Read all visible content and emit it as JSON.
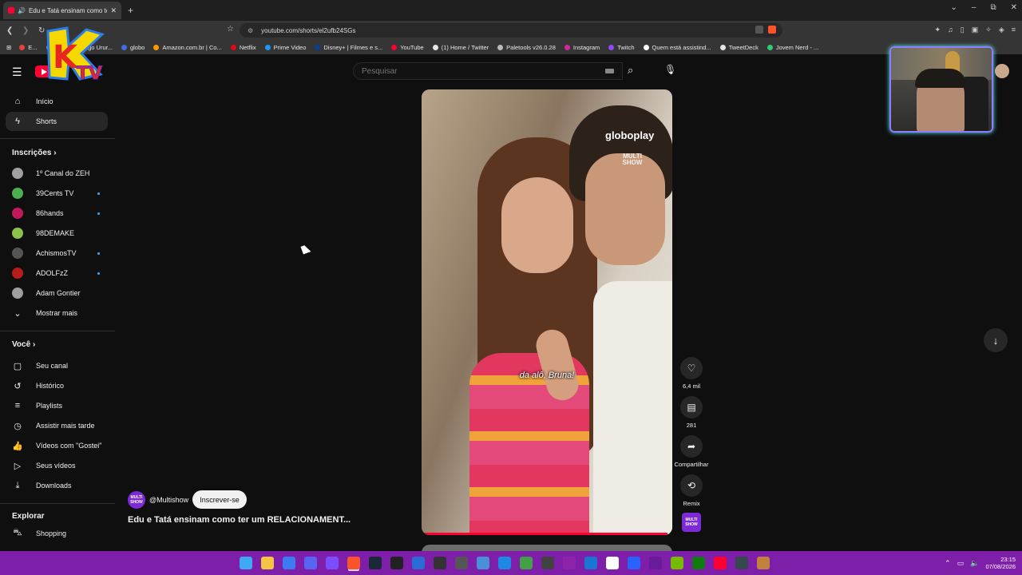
{
  "browser": {
    "tab_title": "Edu e Tatá ensinam como ter",
    "tab_close": "✕",
    "new_tab": "+",
    "window_controls": [
      "⌄",
      "–",
      "⧉",
      "✕"
    ],
    "url": "youtube.com/shorts/el2ufb24SGs",
    "bookmarks": [
      {
        "label": "E...",
        "color": "#ea4335"
      },
      {
        "label": "Email – Thiago Urur...",
        "color": "#4b9fe8"
      },
      {
        "label": "globo",
        "color": "#3b6fe3"
      },
      {
        "label": "Amazon.com.br | Co...",
        "color": "#ff9900"
      },
      {
        "label": "Netflix",
        "color": "#e50914"
      },
      {
        "label": "Prime Video",
        "color": "#1a98ff"
      },
      {
        "label": "Disney+ | Filmes e s...",
        "color": "#0b3d91"
      },
      {
        "label": "YouTube",
        "color": "#ff0033"
      },
      {
        "label": "(1) Home / Twitter",
        "color": "#e6e6e6"
      },
      {
        "label": "Paletools v26.0.28",
        "color": "#bbbbbb"
      },
      {
        "label": "Instagram",
        "color": "#d6249f"
      },
      {
        "label": "Twitch",
        "color": "#9146ff"
      },
      {
        "label": "Quem está assistind...",
        "color": "#ffffff"
      },
      {
        "label": "TweetDeck",
        "color": "#e6e6e6"
      },
      {
        "label": "Jovem Nerd - ...",
        "color": "#2ecc71"
      }
    ]
  },
  "youtube": {
    "search_placeholder": "Pesquisar",
    "sidebar": {
      "main": [
        {
          "label": "Início",
          "icon": "⌂",
          "active": false
        },
        {
          "label": "Shorts",
          "icon": "ϟ",
          "active": true
        }
      ],
      "subscriptions_heading": "Inscrições",
      "subscriptions": [
        {
          "label": "1º Canal do ZEH",
          "color": "#a0a0a0",
          "new": false
        },
        {
          "label": "39Cents TV",
          "color": "#4caf50",
          "new": true
        },
        {
          "label": "86hands",
          "color": "#c2185b",
          "new": true
        },
        {
          "label": "98DEMAKE",
          "color": "#8bc34a",
          "new": false
        },
        {
          "label": "AchismosTV",
          "color": "#555555",
          "new": true
        },
        {
          "label": "ADOLFzZ",
          "color": "#b71c1c",
          "new": true
        },
        {
          "label": "Adam Gontier",
          "color": "#9e9e9e",
          "new": false
        }
      ],
      "show_more": "Mostrar mais",
      "you_heading": "Você",
      "you_items": [
        {
          "label": "Seu canal",
          "icon": "▢"
        },
        {
          "label": "Histórico",
          "icon": "↺"
        },
        {
          "label": "Playlists",
          "icon": "≡"
        },
        {
          "label": "Assistir mais tarde",
          "icon": "◷"
        },
        {
          "label": "Vídeos com \"Gostei\"",
          "icon": "👍"
        },
        {
          "label": "Seus vídeos",
          "icon": "▷"
        },
        {
          "label": "Downloads",
          "icon": "⤓"
        }
      ],
      "explore_heading": "Explorar",
      "explore_items": [
        {
          "label": "Shopping",
          "icon": "⛍"
        }
      ]
    },
    "short": {
      "caption": "da alô, Bruna!",
      "watermark_brand": "globoplay",
      "watermark_channel": "MULTI SHOW",
      "progress": 0.98,
      "channel_handle": "@Multishow",
      "channel_avatar_text": "MULTI SHOW",
      "subscribe_label": "Inscrever-se",
      "title": "Edu e Tatá ensinam como ter um RELACIONAMENT...",
      "actions": {
        "like_count": "6,4 mil",
        "comment_count": "281",
        "share_label": "Compartilhar",
        "remix_label": "Remix"
      }
    }
  },
  "overlay": {
    "logo_letter": "K",
    "logo_text": "TV"
  },
  "taskbar": {
    "time": "23:15",
    "date": "07/08/2026",
    "icons": [
      {
        "name": "windows-start-icon",
        "color": "#3fa9f5"
      },
      {
        "name": "file-explorer-icon",
        "color": "#f4c542"
      },
      {
        "name": "browser-icon",
        "color": "#3d7bf2"
      },
      {
        "name": "discord-icon",
        "color": "#5865f2"
      },
      {
        "name": "app-icon",
        "color": "#7c4dff"
      },
      {
        "name": "brave-icon",
        "color": "#fb542b"
      },
      {
        "name": "steam-icon",
        "color": "#1b2838"
      },
      {
        "name": "terminal-icon",
        "color": "#222222"
      },
      {
        "name": "app-icon",
        "color": "#2b6bd6"
      },
      {
        "name": "app-icon",
        "color": "#333333"
      },
      {
        "name": "app-icon",
        "color": "#555555"
      },
      {
        "name": "app-icon",
        "color": "#4a90d9"
      },
      {
        "name": "app-icon",
        "color": "#1e88e5"
      },
      {
        "name": "app-icon",
        "color": "#43a047"
      },
      {
        "name": "app-icon",
        "color": "#424242"
      },
      {
        "name": "app-icon",
        "color": "#8e24aa"
      },
      {
        "name": "app-icon",
        "color": "#1976d2"
      },
      {
        "name": "app-icon",
        "color": "#ffffff"
      },
      {
        "name": "app-icon",
        "color": "#2962ff"
      },
      {
        "name": "app-icon",
        "color": "#6a1b9a"
      },
      {
        "name": "nvidia-icon",
        "color": "#76b900"
      },
      {
        "name": "xbox-icon",
        "color": "#107c10"
      },
      {
        "name": "youtube-music-icon",
        "color": "#ff0033"
      },
      {
        "name": "app-icon",
        "color": "#37474f"
      },
      {
        "name": "app-icon",
        "color": "#c1813a"
      }
    ]
  }
}
